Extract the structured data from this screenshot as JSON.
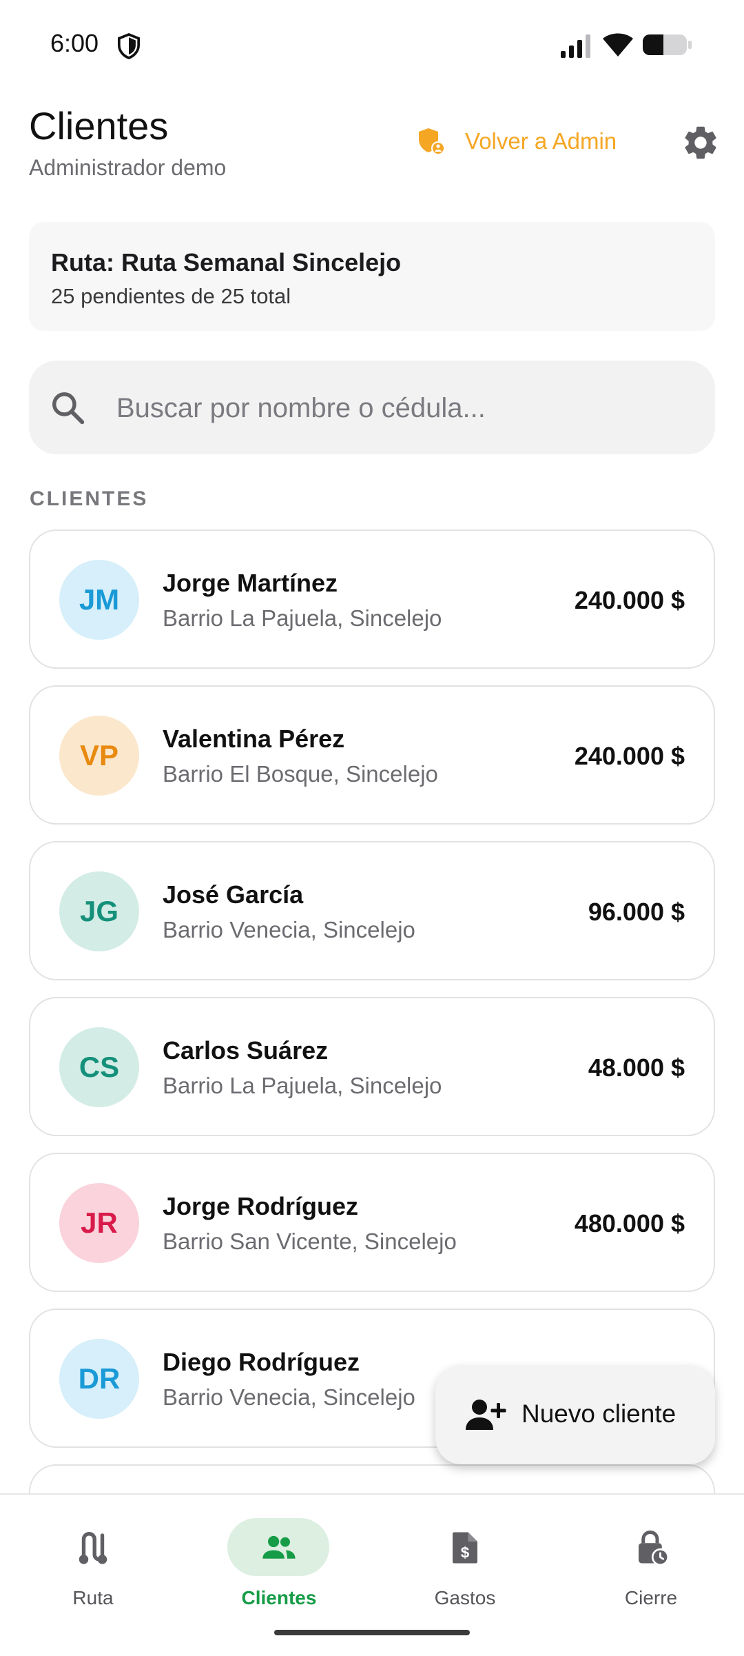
{
  "status_bar": {
    "time": "6:00"
  },
  "header": {
    "title": "Clientes",
    "subtitle": "Administrador demo",
    "admin_button_label": "Volver a Admin"
  },
  "route": {
    "name": "Ruta: Ruta Semanal Sincelejo",
    "stats": "25 pendientes de 25 total"
  },
  "search": {
    "placeholder": "Buscar por nombre o cédula...",
    "value": ""
  },
  "section_label": "CLIENTES",
  "clients": [
    {
      "initials": "JM",
      "name": "Jorge Martínez",
      "address": "Barrio La Pajuela, Sincelejo",
      "amount": "240.000 $",
      "avatar_bg": "#d6effa",
      "avatar_fg": "#1a9ad6"
    },
    {
      "initials": "VP",
      "name": "Valentina Pérez",
      "address": "Barrio El Bosque, Sincelejo",
      "amount": "240.000 $",
      "avatar_bg": "#fbe7cc",
      "avatar_fg": "#e88a10"
    },
    {
      "initials": "JG",
      "name": "José García",
      "address": "Barrio Venecia, Sincelejo",
      "amount": "96.000 $",
      "avatar_bg": "#d3ede6",
      "avatar_fg": "#15907a"
    },
    {
      "initials": "CS",
      "name": "Carlos Suárez",
      "address": "Barrio La Pajuela, Sincelejo",
      "amount": "48.000 $",
      "avatar_bg": "#d3ede6",
      "avatar_fg": "#15907a"
    },
    {
      "initials": "JR",
      "name": "Jorge Rodríguez",
      "address": "Barrio San Vicente, Sincelejo",
      "amount": "480.000 $",
      "avatar_bg": "#fad3dc",
      "avatar_fg": "#d81b4a"
    },
    {
      "initials": "DR",
      "name": "Diego Rodríguez",
      "address": "Barrio Venecia, Sincelejo",
      "amount": "",
      "avatar_bg": "#d6effa",
      "avatar_fg": "#1a9ad6"
    }
  ],
  "fab": {
    "label": "Nuevo cliente",
    "icon": "person-add-icon"
  },
  "nav": {
    "items": [
      {
        "label": "Ruta",
        "icon": "route-icon",
        "active": false
      },
      {
        "label": "Clientes",
        "icon": "people-icon",
        "active": true
      },
      {
        "label": "Gastos",
        "icon": "receipt-dollar-icon",
        "active": false
      },
      {
        "label": "Cierre",
        "icon": "lock-clock-icon",
        "active": false
      }
    ]
  },
  "colors": {
    "accent_green": "#169c47",
    "admin_orange": "#f5a623"
  }
}
